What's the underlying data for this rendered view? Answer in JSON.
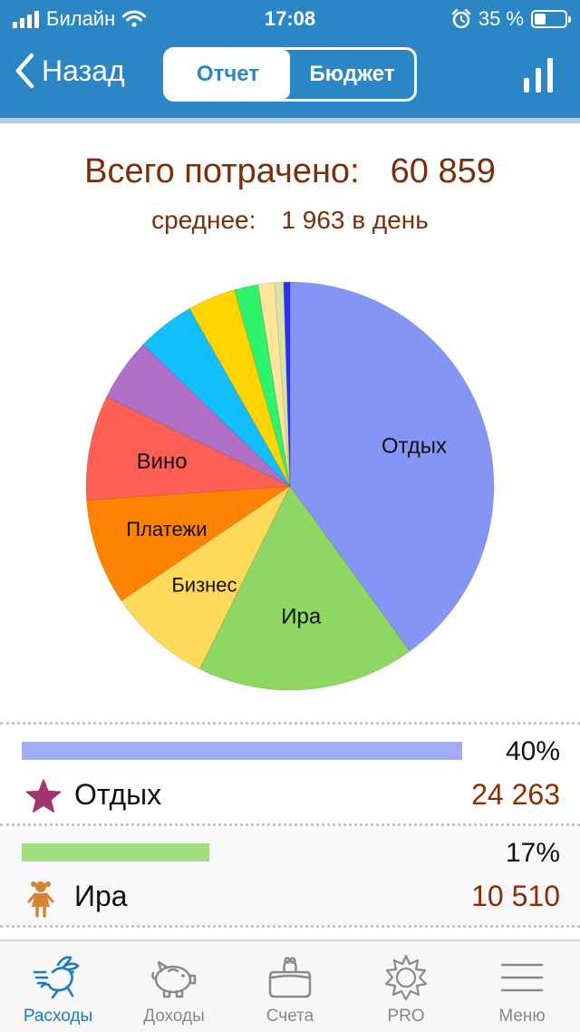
{
  "status": {
    "carrier": "Билайн",
    "time": "17:08",
    "battery": "35 %"
  },
  "nav": {
    "back_label": "Назад",
    "segments": [
      "Отчет",
      "Бюджет"
    ],
    "active_segment": 0
  },
  "summary": {
    "total_label": "Всего потрачено:",
    "total_value": "60 859",
    "avg_label": "среднее:",
    "avg_value": "1 963 в день"
  },
  "chart_data": {
    "type": "pie",
    "slices": [
      {
        "label": "Отдых",
        "value": 40,
        "color": "#8595f5"
      },
      {
        "label": "Ира",
        "value": 17.3,
        "color": "#8fd763"
      },
      {
        "label": "Бизнес",
        "value": 8.2,
        "color": "#ffd95a"
      },
      {
        "label": "Платежи",
        "value": 8.4,
        "color": "#ff8300"
      },
      {
        "label": "Вино",
        "value": 8.3,
        "color": "#ff5f55"
      },
      {
        "label": "",
        "value": 5.0,
        "color": "#b070c8"
      },
      {
        "label": "",
        "value": 4.6,
        "color": "#12c0ff"
      },
      {
        "label": "",
        "value": 3.8,
        "color": "#ffd500"
      },
      {
        "label": "",
        "value": 1.9,
        "color": "#2ef36d"
      },
      {
        "label": "",
        "value": 1.3,
        "color": "#ffe59a"
      },
      {
        "label": "",
        "value": 0.7,
        "color": "#d9e5a8"
      },
      {
        "label": "",
        "value": 0.5,
        "color": "#2a2ff5"
      }
    ]
  },
  "categories": [
    {
      "name": "Отдых",
      "percent_label": "40%",
      "fraction": 0.4,
      "amount": "24 263",
      "bar_color": "#a3abf4",
      "icon": "star-icon"
    },
    {
      "name": "Ира",
      "percent_label": "17%",
      "fraction": 0.17,
      "amount": "10 510",
      "bar_color": "#a2dd80",
      "icon": "girl-icon"
    }
  ],
  "tabs": [
    {
      "label": "Расходы",
      "icon": "running-rabbit-icon",
      "active": true
    },
    {
      "label": "Доходы",
      "icon": "piggy-bank-icon",
      "active": false
    },
    {
      "label": "Счета",
      "icon": "wallet-icon",
      "active": false
    },
    {
      "label": "PRO",
      "icon": "sun-icon",
      "active": false
    },
    {
      "label": "Меню",
      "icon": "menu-icon",
      "active": false
    }
  ]
}
